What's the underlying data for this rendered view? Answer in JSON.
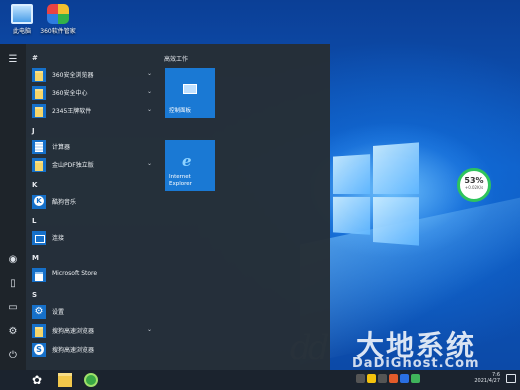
{
  "desktop": {
    "icons": [
      {
        "label": "此电脑",
        "icon": "this-pc-icon"
      },
      {
        "label": "360软件管家",
        "icon": "software-manager-icon"
      }
    ],
    "network_widget": {
      "percent": "53%",
      "speed": "+0.02K/s"
    },
    "watermark": {
      "text": "大地系统",
      "url": "DaDiGhost.Com"
    }
  },
  "start_menu": {
    "rail_icons": [
      "hamburger-icon",
      "user-icon",
      "document-icon",
      "pictures-icon",
      "settings-icon",
      "power-icon"
    ],
    "sections": [
      {
        "letter": "#",
        "apps": [
          {
            "name": "360安全浏览器",
            "icon": "folder-icon",
            "expandable": true
          },
          {
            "name": "360安全中心",
            "icon": "folder-icon",
            "expandable": true
          },
          {
            "name": "2345王牌软件",
            "icon": "folder-icon",
            "expandable": true
          }
        ]
      },
      {
        "letter": "J",
        "apps": [
          {
            "name": "计算器",
            "icon": "calculator-icon",
            "expandable": false
          },
          {
            "name": "金山PDF独立版",
            "icon": "folder-icon",
            "expandable": true
          }
        ]
      },
      {
        "letter": "K",
        "apps": [
          {
            "name": "酷狗音乐",
            "icon": "kugou-icon",
            "expandable": false
          }
        ]
      },
      {
        "letter": "L",
        "apps": [
          {
            "name": "连接",
            "icon": "connect-icon",
            "expandable": false
          }
        ]
      },
      {
        "letter": "M",
        "apps": [
          {
            "name": "Microsoft Store",
            "icon": "store-icon",
            "expandable": false
          }
        ]
      },
      {
        "letter": "S",
        "apps": [
          {
            "name": "设置",
            "icon": "settings-gear-icon",
            "expandable": false
          },
          {
            "name": "搜狗高速浏览器",
            "icon": "folder-icon",
            "expandable": true
          },
          {
            "name": "搜狗高速浏览器",
            "icon": "sogou-icon",
            "expandable": false
          }
        ]
      }
    ],
    "tiles_group": {
      "title": "高效工作",
      "tiles": [
        {
          "label": "控制面板",
          "icon": "control-panel-icon"
        },
        {
          "label": "Internet Explorer",
          "icon": "ie-icon"
        }
      ]
    },
    "chevron": "⌄"
  },
  "taskbar": {
    "start_glyph": "✿",
    "clock": {
      "line1": "7:6",
      "line2": "2021/4/27"
    }
  }
}
